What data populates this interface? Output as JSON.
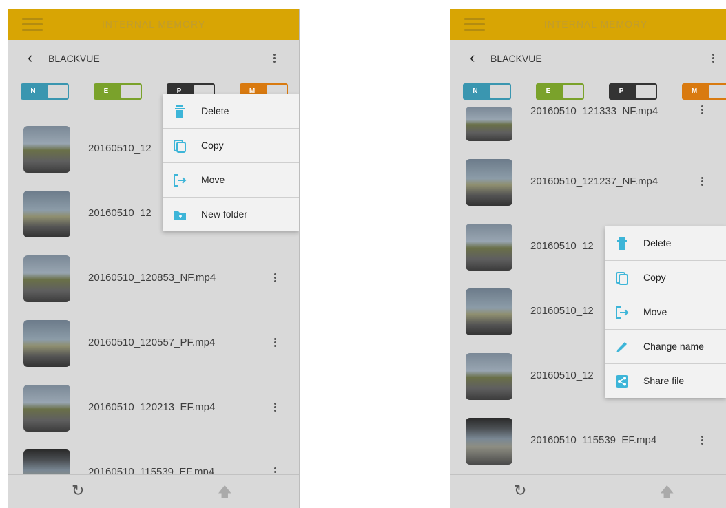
{
  "colors": {
    "header": "#d8a504",
    "accent": "#3db5d8",
    "screen_dim": "#d9d9d9"
  },
  "left": {
    "title": "INTERNAL MEMORY",
    "folder": "BLACKVUE",
    "filters": [
      {
        "label": "N",
        "color": "#3a96b0"
      },
      {
        "label": "E",
        "color": "#7aa22b"
      },
      {
        "label": "P",
        "color": "#333333"
      },
      {
        "label": "M",
        "color": "#d97a10"
      }
    ],
    "files": [
      "20160510_12",
      "20160510_12",
      "20160510_120853_NF.mp4",
      "20160510_120557_PF.mp4",
      "20160510_120213_EF.mp4",
      "20160510_115539_EF.mp4"
    ],
    "menu": [
      {
        "label": "Delete",
        "icon": "trash-icon"
      },
      {
        "label": "Copy",
        "icon": "copy-icon"
      },
      {
        "label": "Move",
        "icon": "move-icon"
      },
      {
        "label": "New folder",
        "icon": "folder-icon"
      }
    ]
  },
  "right": {
    "title": "INTERNAL MEMORY",
    "folder": "BLACKVUE",
    "filters": [
      {
        "label": "N",
        "color": "#3a96b0"
      },
      {
        "label": "E",
        "color": "#7aa22b"
      },
      {
        "label": "P",
        "color": "#333333"
      },
      {
        "label": "M",
        "color": "#d97a10"
      }
    ],
    "files": [
      "20160510_121333_NF.mp4",
      "20160510_121237_NF.mp4",
      "20160510_12",
      "20160510_12",
      "20160510_12",
      "20160510_115539_EF.mp4"
    ],
    "menu": [
      {
        "label": "Delete",
        "icon": "trash-icon"
      },
      {
        "label": "Copy",
        "icon": "copy-icon"
      },
      {
        "label": "Move",
        "icon": "move-icon"
      },
      {
        "label": "Change name",
        "icon": "pencil-icon"
      },
      {
        "label": "Share file",
        "icon": "share-icon"
      }
    ]
  }
}
